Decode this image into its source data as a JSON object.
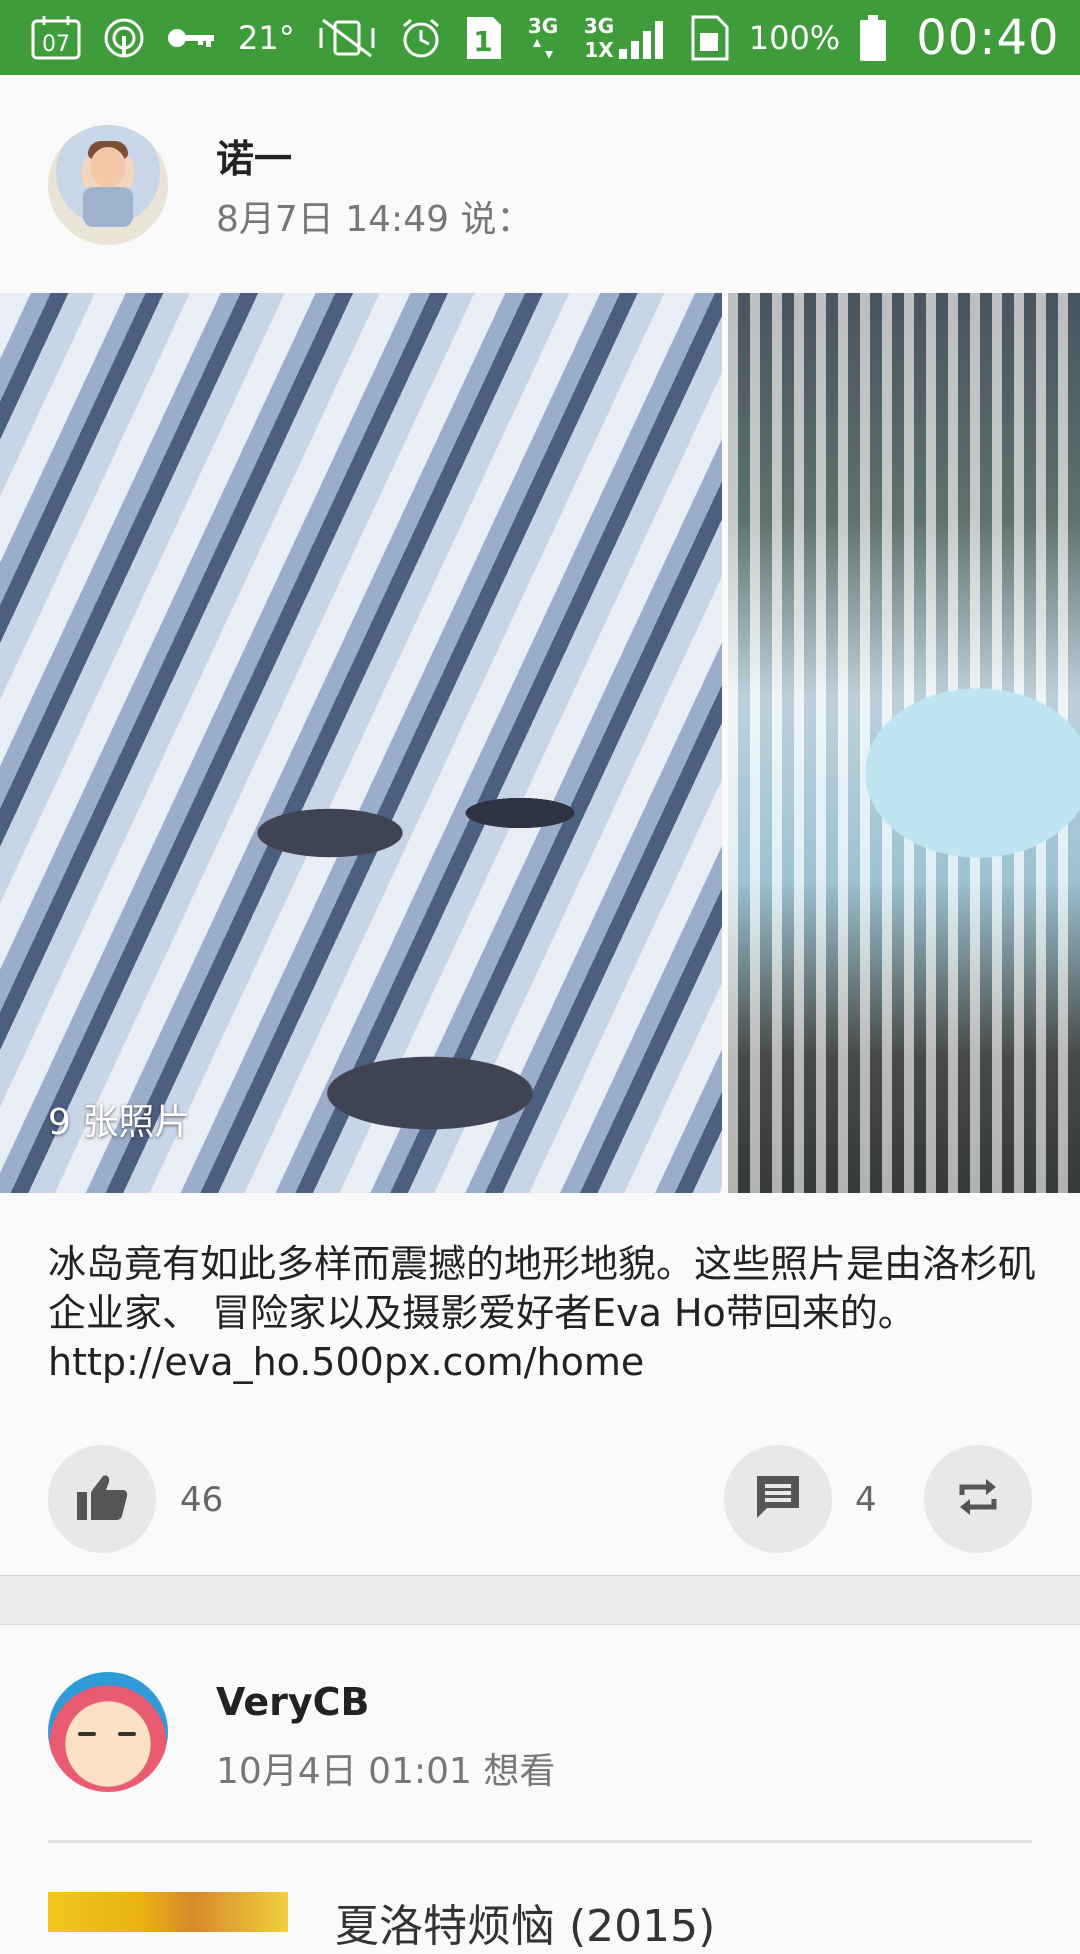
{
  "status_bar": {
    "calendar_day": "07",
    "temperature": "21°",
    "sim_slot": "1",
    "net_1": "3G",
    "net_2": "3G",
    "net_2_sub": "1X",
    "battery": "100%",
    "time": "00:40",
    "bg_color": "#3f9c3a"
  },
  "post1": {
    "author": "诺一",
    "meta": "8月7日 14:49 说：",
    "photo_count": "9 张照片",
    "text": "冰岛竟有如此多样而震撼的地形地貌。这些照片是由洛杉矶企业家、 冒险家以及摄影爱好者Eva Ho带回来的。http://eva_ho.500px.com/home",
    "likes": "46",
    "comments": "4",
    "icons": [
      "thumb-up-icon",
      "comment-icon",
      "repost-icon"
    ]
  },
  "post2": {
    "author": "VeryCB",
    "meta": "10月4日 01:01 想看",
    "movie_title": "夏洛特烦恼 (2015)"
  }
}
